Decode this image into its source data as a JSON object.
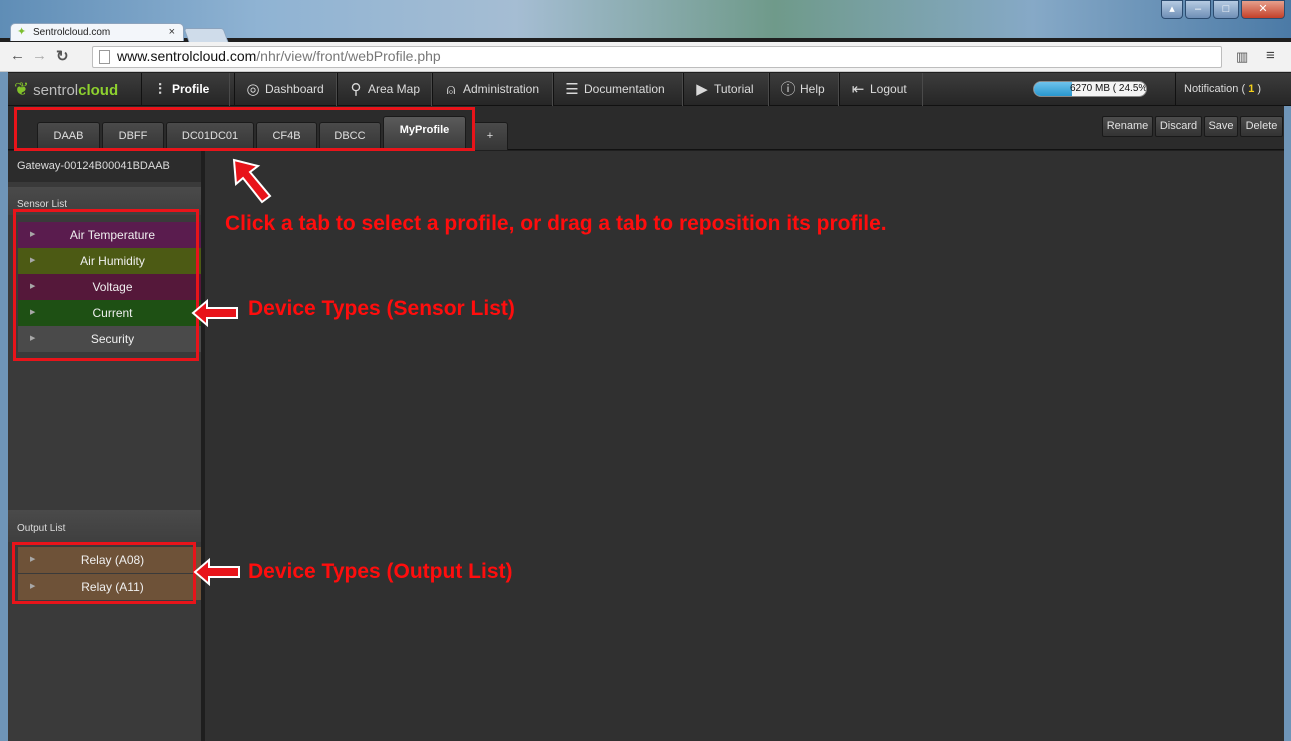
{
  "browser": {
    "tab_title": "Sentrolcloud.com",
    "url_host": "www.sentrolcloud.com",
    "url_path": "/nhr/view/front/webProfile.php"
  },
  "app": {
    "logo_text": "sentrol",
    "logo_bold": "cloud",
    "nav": [
      {
        "label": "Profile",
        "icon": "sliders-icon"
      },
      {
        "label": "Dashboard",
        "icon": "dashboard-icon"
      },
      {
        "label": "Area Map",
        "icon": "map-pin-icon"
      },
      {
        "label": "Administration",
        "icon": "user-icon"
      },
      {
        "label": "Documentation",
        "icon": "document-icon"
      },
      {
        "label": "Tutorial",
        "icon": "play-icon"
      },
      {
        "label": "Help",
        "icon": "info-icon"
      },
      {
        "label": "Logout",
        "icon": "logout-icon"
      }
    ],
    "storage_text": "6270 MB ( 24.5% )",
    "storage_fraction": 0.245,
    "notification_label": "Notification (",
    "notification_count": "1",
    "notification_close": ")"
  },
  "profile_tabs": [
    "DAAB",
    "DBFF",
    "DC01DC01",
    "CF4B",
    "DBCC",
    "MyProfile",
    "+"
  ],
  "actions": [
    "Rename",
    "Discard",
    "Save",
    "Delete"
  ],
  "sidebar": {
    "gateway": "Gateway-00124B00041BDAAB",
    "sensor_heading": "Sensor List",
    "sensors": [
      {
        "label": "Air Temperature",
        "color": "#5a1c4e"
      },
      {
        "label": "Air Humidity",
        "color": "#4c5a14"
      },
      {
        "label": "Voltage",
        "color": "#55183a"
      },
      {
        "label": "Current",
        "color": "#1e5014"
      },
      {
        "label": "Security",
        "color": "#4a4a4a"
      }
    ],
    "output_heading": "Output List",
    "outputs": [
      {
        "label": "Relay (A08)",
        "color": "#6e5238"
      },
      {
        "label": "Relay (A11)",
        "color": "#6e5238"
      }
    ]
  },
  "annotations": {
    "tabs_note": "Click a tab to select a profile, or drag a tab to reposition its profile.",
    "sensor_note": "Device Types (Sensor List)",
    "output_note": "Device Types (Output List)"
  }
}
